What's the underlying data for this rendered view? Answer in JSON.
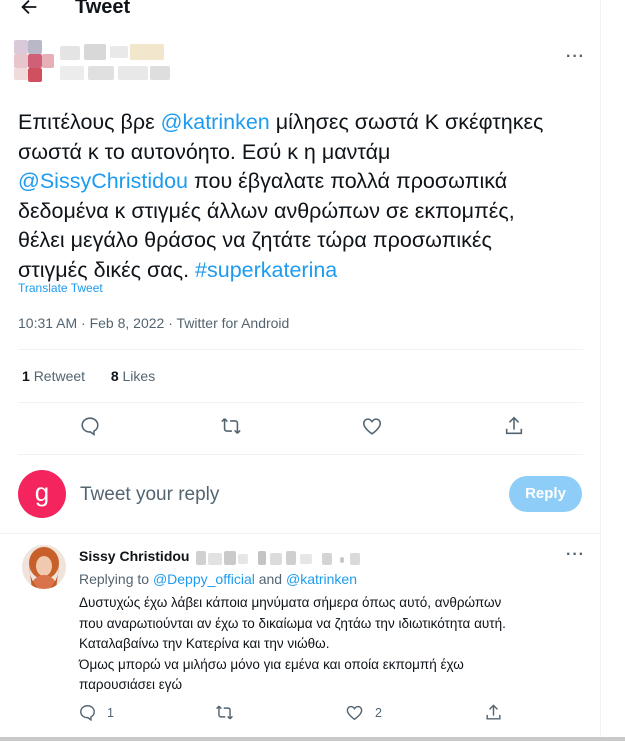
{
  "header": {
    "title": "Tweet",
    "back_icon": "arrow-left-icon"
  },
  "tweet": {
    "text_lines": [
      [
        "Επιτέλους βρε ",
        "@katrinken",
        " μίλησες σωστά Κ σκέφτηκες"
      ],
      [
        "σωστά κ το αυτονόητο. Εσύ κ η μαντάμ"
      ],
      [
        "",
        "@SissyChristidou",
        " που έβγαλατε πολλά προσωπικά"
      ],
      [
        "δεδομένα κ στιγμές άλλων ανθρώπων σε εκπομπές,"
      ],
      [
        "θέλει μεγάλο θράσος να ζητάτε τώρα προσωπικές"
      ],
      [
        "στιγμές δικές σας. ",
        "#superkaterina"
      ]
    ],
    "translate": "Translate Tweet",
    "meta": "10:31 AM · Feb 8, 2022 · Twitter for Android",
    "retweets_count": "1",
    "retweets_label": "Retweet",
    "likes_count": "8",
    "likes_label": "Likes",
    "more_icon": "more-icon"
  },
  "composer": {
    "avatar_letter": "g",
    "placeholder": "Tweet your reply",
    "button": "Reply"
  },
  "reply": {
    "name": "Sissy Christidou",
    "replying_prefix": "Replying to ",
    "replying_user1": "@Deppy_official",
    "replying_and": " and ",
    "replying_user2": "@katrinken",
    "lines": [
      "Δυστυχώς έχω λάβει κάποια μηνύματα σήμερα όπως αυτό, ανθρώπων",
      "που αναρωτιούνται αν έχω το δικαίωμα να ζητάω την ιδιωτικότητα αυτή.",
      "Καταλαβαίνω την Κατερίνα και την νιώθω.",
      "Όμως μπορώ να μιλήσω μόνο για εμένα και οποία εκπομπή έχω",
      "παρουσιάσει εγώ"
    ],
    "reply_count": "1",
    "like_count": "2"
  },
  "colors": {
    "accent": "#1d9bf0",
    "reply_button": "#8ecdf8",
    "avatar_g": "#f4245e"
  }
}
